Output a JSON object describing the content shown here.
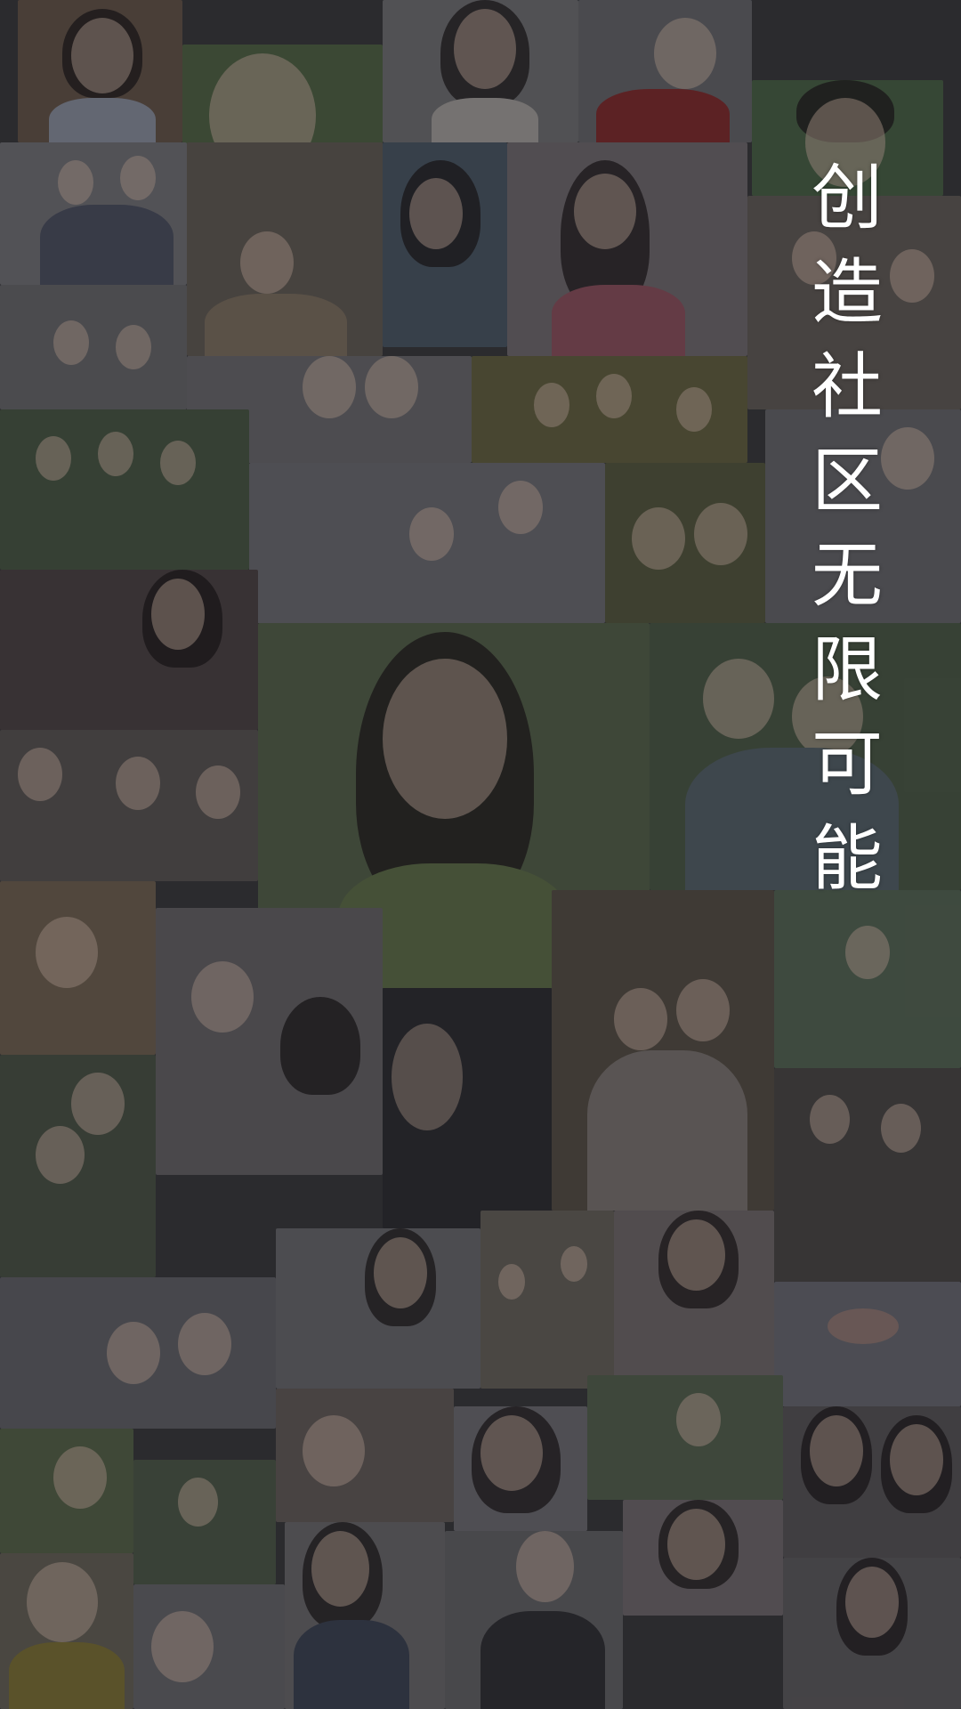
{
  "splash": {
    "slogan_chars": [
      "创",
      "造",
      "社",
      "区",
      "无",
      "限",
      "可",
      "能"
    ],
    "text_color": "#ffffff",
    "overlay_color": "#1a1a1c"
  },
  "collage": {
    "icon": "photo-collage-background"
  }
}
